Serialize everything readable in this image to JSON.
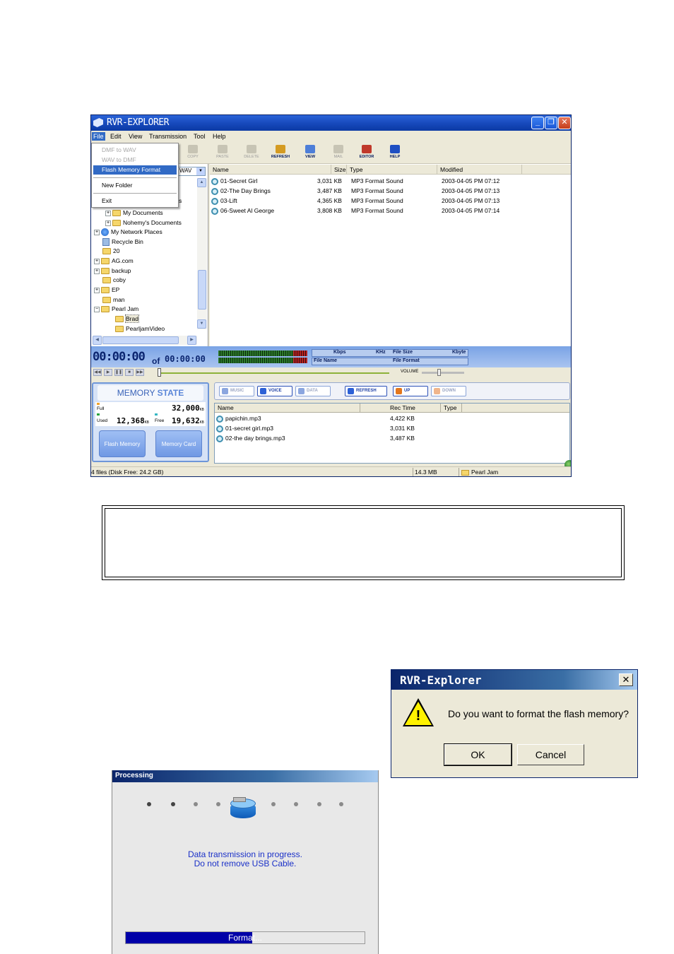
{
  "main_window": {
    "title": "RVR-EXPLORER",
    "menu": [
      "File",
      "Edit",
      "View",
      "Transmission",
      "Tool",
      "Help"
    ],
    "file_menu": {
      "items": [
        "DMF to WAV",
        "WAV to DMF",
        "Flash Memory Format",
        "New Folder",
        "Exit"
      ],
      "selected": "Flash Memory Format"
    },
    "toolbar": [
      "COPY",
      "PASTE",
      "DELETE",
      "REFRESH",
      "VIEW",
      "MAIL",
      "EDITOR",
      "HELP"
    ],
    "format_select": "WAV",
    "tree": [
      {
        "label": "s"
      },
      {
        "label": "My Documents"
      },
      {
        "label": "Nohemy's Documents"
      },
      {
        "label": "My Network Places"
      },
      {
        "label": "Recycle Bin"
      },
      {
        "label": "20"
      },
      {
        "label": "AG.com"
      },
      {
        "label": "backup"
      },
      {
        "label": "coby"
      },
      {
        "label": "EP"
      },
      {
        "label": "man"
      },
      {
        "label": "Pearl Jam"
      },
      {
        "label": "Brad"
      },
      {
        "label": "PearljamVideo"
      }
    ],
    "file_list": {
      "columns": [
        "Name",
        "Size",
        "Type",
        "Modified"
      ],
      "rows": [
        {
          "name": "01-Secret Girl",
          "size": "3,031 KB",
          "type": "MP3 Format Sound",
          "modified": "2003-04-05 PM 07:12"
        },
        {
          "name": "02-The Day Brings",
          "size": "3,487 KB",
          "type": "MP3 Format Sound",
          "modified": "2003-04-05 PM 07:13"
        },
        {
          "name": "03-Lift",
          "size": "4,365 KB",
          "type": "MP3 Format Sound",
          "modified": "2003-04-05 PM 07:13"
        },
        {
          "name": "06-Sweet Al George",
          "size": "3,808 KB",
          "type": "MP3 Format Sound",
          "modified": "2003-04-05 PM 07:14"
        }
      ]
    },
    "player": {
      "time": "00:00:00",
      "of": "of",
      "total": "00:00:00",
      "kbps": "Kbps",
      "khz": "KHz",
      "file_size": "File Size",
      "kbyte": "Kbyte",
      "file_name": "File Name",
      "file_format": "File Format",
      "volume": "VOLUME"
    },
    "memory_state": {
      "title_a": "MEMORY ",
      "title_b": "STATE",
      "full_label": "Full",
      "full_value": "32,000",
      "used_label": "Used",
      "used_value": "12,368",
      "free_label": "Free",
      "free_value": "19,632",
      "unit": "KB",
      "flash_button": "Flash Memory",
      "card_button": "Memory Card"
    },
    "device_tabs": [
      "MUSIC",
      "VOICE",
      "DATA",
      "REFRESH",
      "UP",
      "DOWN"
    ],
    "device_list": {
      "columns": [
        "Name",
        "Rec Time",
        "Type"
      ],
      "rows": [
        {
          "name": "papichin.mp3",
          "rec": "4,422 KB"
        },
        {
          "name": "01-secret girl.mp3",
          "rec": "3,031 KB"
        },
        {
          "name": "02-the day brings.mp3",
          "rec": "3,487 KB"
        }
      ]
    },
    "status": {
      "files": "4 files (Disk Free: 24.2 GB)",
      "size": "14.3 MB",
      "folder": "Pearl Jam"
    }
  },
  "dialog": {
    "title": "RVR-Explorer",
    "close": "✕",
    "message": "Do you want to format the flash memory?",
    "ok": "OK",
    "cancel": "Cancel"
  },
  "processing": {
    "title": "Processing",
    "line1": "Data transmission in progress.",
    "line2": "Do not remove USB Cable.",
    "progress_label": "Format...",
    "progress_fraction": 0.53
  },
  "colors": {
    "xp_title_blue": "#1546b8",
    "classic_title_blue": "#0a246a",
    "progress_fill": "#0000a8",
    "menu_highlight": "#316ac5"
  }
}
